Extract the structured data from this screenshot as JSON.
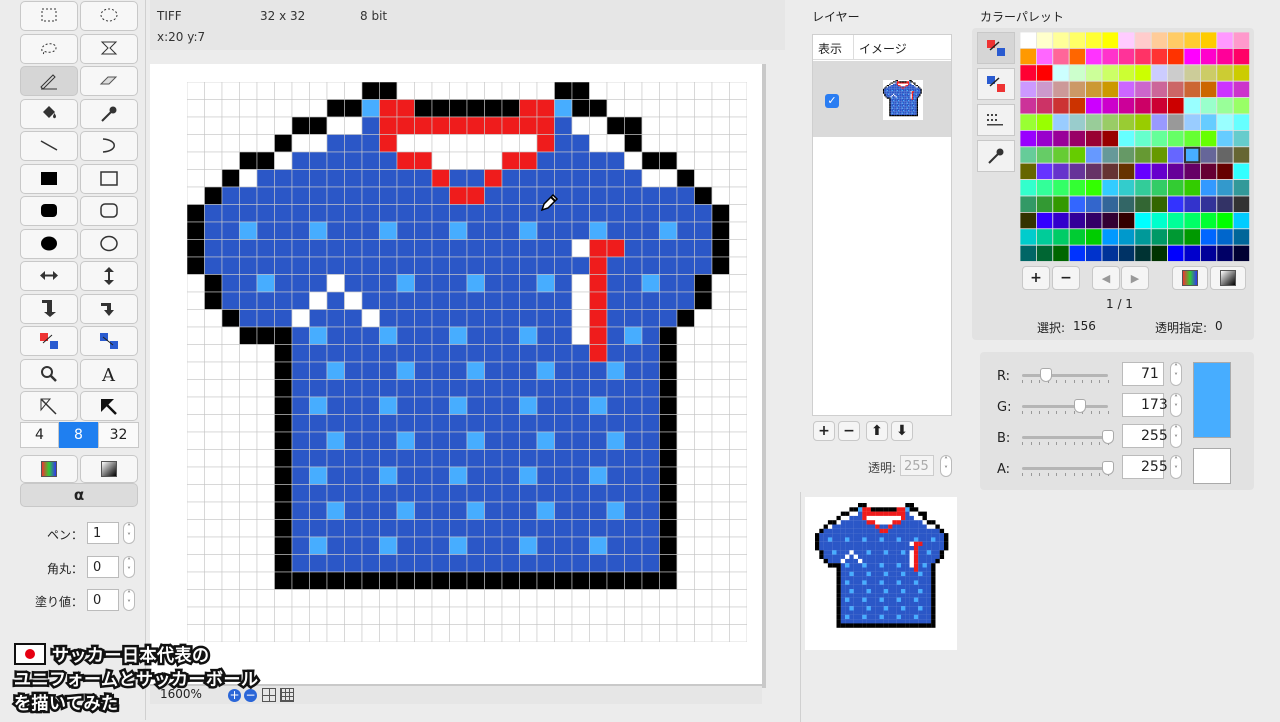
{
  "info": {
    "format": "TIFF",
    "size": "32 x 32",
    "depth": "8 bit",
    "coords": "x:20 y:7"
  },
  "toolbar": {
    "tools": [
      "rect-select-icon",
      "ellipse-select-icon",
      "lasso-icon",
      "magic-wand-icon",
      "pencil-icon",
      "eraser-icon",
      "fill-bucket-icon",
      "eyedropper-icon",
      "line-icon",
      "curve-icon",
      "filled-rect-icon",
      "rect-icon",
      "filled-rounded-rect-icon",
      "rounded-rect-icon",
      "filled-ellipse-icon",
      "ellipse-icon",
      "flip-horizontal-icon",
      "flip-vertical-icon",
      "move-left-down-icon",
      "move-right-down-icon",
      "swap-colors-icon",
      "swap-colors-alt-icon",
      "zoom-icon",
      "text-icon",
      "shape-cut-icon",
      "shape-paste-icon"
    ],
    "sizes": [
      "4",
      "8",
      "32"
    ],
    "alpha_label": "α",
    "pen_label": "ペン：",
    "pen_value": "1",
    "corner_label": "角丸：",
    "corner_value": "0",
    "fill_label": "塗り値：",
    "fill_value": "0"
  },
  "zoom": {
    "level": "1600%"
  },
  "layers": {
    "title": "レイヤー",
    "col_show": "表示",
    "col_image": "イメージ",
    "opacity_label": "透明:",
    "opacity_value": "255"
  },
  "palette": {
    "title": "カラーパレット",
    "page": "1 / 1",
    "selected_label": "選択:",
    "selected_value": "156",
    "transparent_label": "透明指定:",
    "transparent_value": "0"
  },
  "color": {
    "r_label": "R:",
    "r": "71",
    "g_label": "G:",
    "g": "173",
    "b_label": "B:",
    "b": "255",
    "a_label": "A:",
    "a": "255",
    "swatch": "#47adff"
  },
  "overlay": {
    "line1": "サッカー日本代表の",
    "line2": "ユニフォームとサッカーボール",
    "line3": "を描いてみた"
  }
}
